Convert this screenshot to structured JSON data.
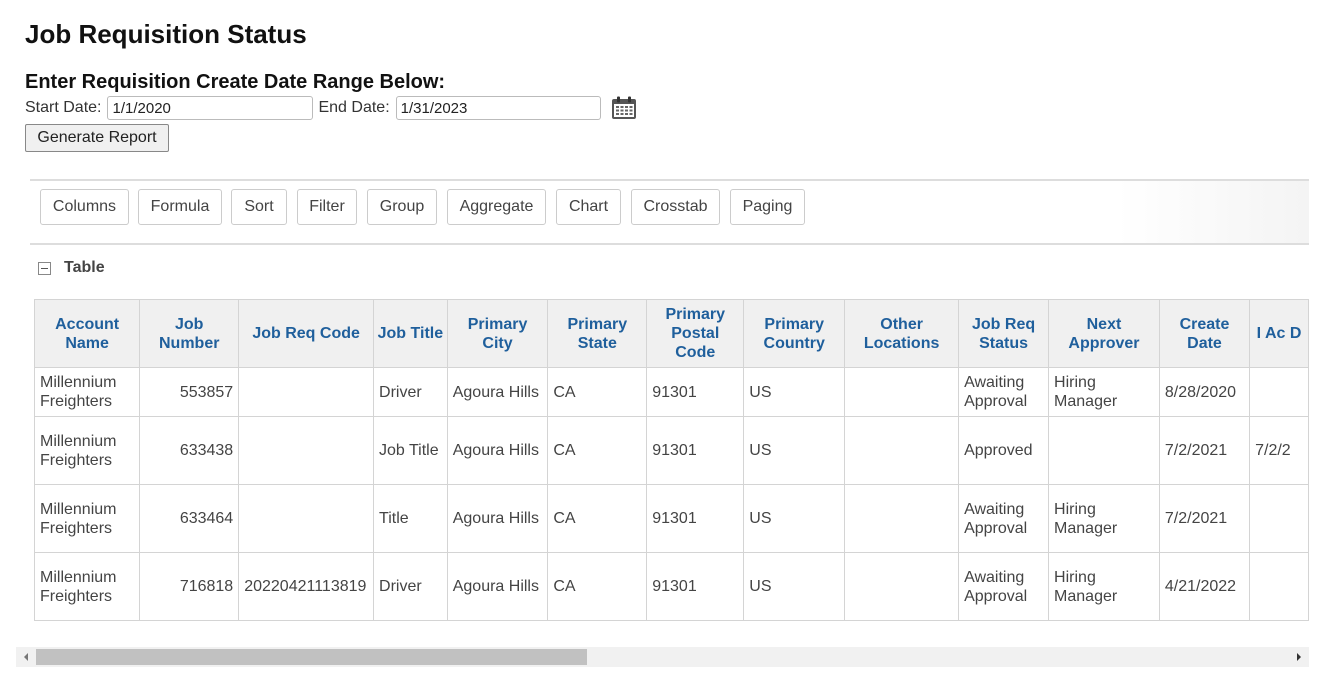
{
  "page": {
    "title": "Job Requisition Status",
    "subtitle": "Enter Requisition Create Date Range Below:"
  },
  "filters": {
    "start_label": "Start Date:",
    "start_value": "1/1/2020",
    "end_label": "End Date:",
    "end_value": "1/31/2023",
    "calendar_icon": "calendar-icon",
    "generate_label": "Generate Report"
  },
  "toolbar": {
    "items": [
      "Columns",
      "Formula",
      "Sort",
      "Filter",
      "Group",
      "Aggregate",
      "Chart",
      "Crosstab",
      "Paging"
    ]
  },
  "table_section": {
    "label": "Table",
    "collapse_icon": "collapse-minus-icon"
  },
  "grid": {
    "headers": [
      "Account Name",
      "Job Number",
      "Job Req Code",
      "Job Title",
      "Primary City",
      "Primary State",
      "Primary Postal Code",
      "Primary Country",
      "Other Locations",
      "Job Req Status",
      "Next Approver",
      "Create Date",
      "I Ac D"
    ],
    "rows": [
      [
        "Millennium Freighters",
        "553857",
        "",
        "Driver",
        "Agoura Hills",
        "CA",
        "91301",
        "US",
        "",
        "Awaiting Approval",
        "Hiring Manager",
        "8/28/2020",
        ""
      ],
      [
        "Millennium Freighters",
        "633438",
        "",
        "Job Title",
        "Agoura Hills",
        "CA",
        "91301",
        "US",
        "",
        "Approved",
        "",
        "7/2/2021",
        "7/2/2"
      ],
      [
        "Millennium Freighters",
        "633464",
        "",
        "Title",
        "Agoura Hills",
        "CA",
        "91301",
        "US",
        "",
        "Awaiting Approval",
        "Hiring Manager",
        "7/2/2021",
        ""
      ],
      [
        "Millennium Freighters",
        "716818",
        "20220421113819",
        "Driver",
        "Agoura Hills",
        "CA",
        "91301",
        "US",
        "",
        "Awaiting Approval",
        "Hiring Manager",
        "4/21/2022",
        ""
      ]
    ]
  },
  "scrollbar": {
    "position_fraction": 0.0,
    "visible_fraction": 0.44
  }
}
